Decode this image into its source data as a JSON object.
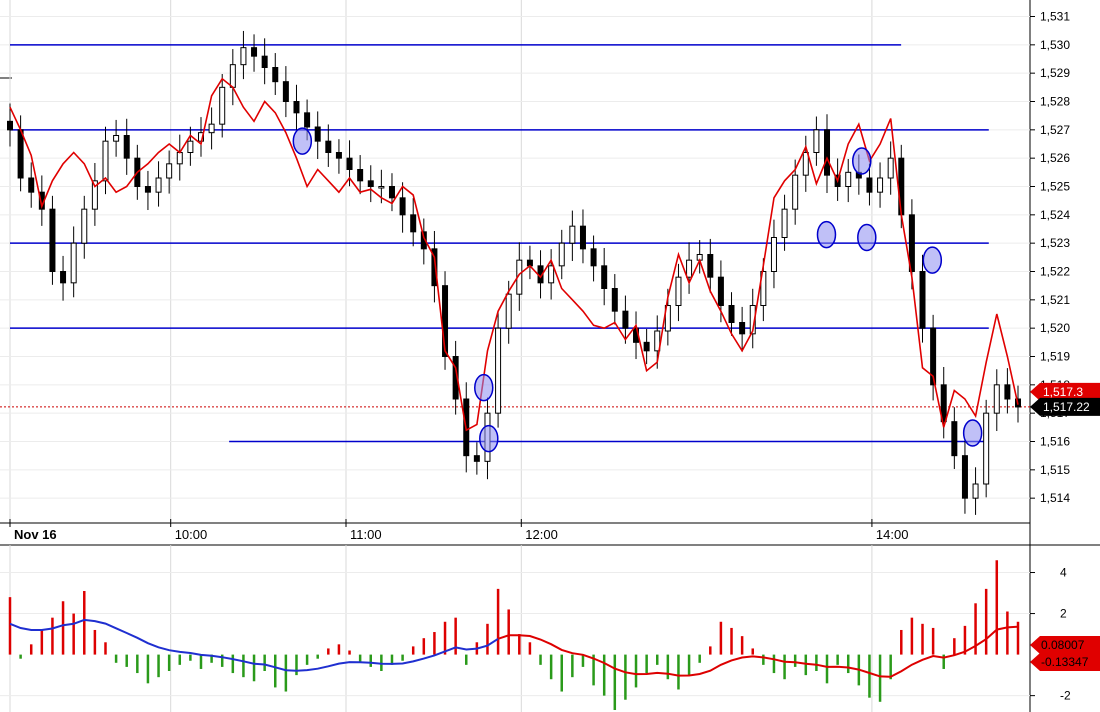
{
  "chart_data": [
    {
      "type": "candlestick",
      "panel": "price",
      "ylim": [
        1513.3,
        1531.3
      ],
      "y_ticks": [
        "1,514",
        "1,515",
        "1,516",
        "1,517",
        "1,518",
        "1,519",
        "1,520",
        "1,521",
        "1,522",
        "1,523",
        "1,524",
        "1,525",
        "1,526",
        "1,527",
        "1,528",
        "1,529",
        "1,530",
        "1,531"
      ],
      "x_labels": [
        {
          "label": "Nov 16",
          "time": "09:05"
        },
        {
          "label": "10:00",
          "time": "10:00"
        },
        {
          "label": "11:00",
          "time": "11:00"
        },
        {
          "label": "12:00",
          "time": "12:00"
        },
        {
          "label": "14:00",
          "time": "14:00"
        }
      ],
      "time_range": [
        "09:05",
        "14:50"
      ],
      "horizontal_levels": [
        {
          "value": 1530,
          "from": "09:05",
          "to": "14:10"
        },
        {
          "value": 1527,
          "from": "09:05",
          "to": "14:40"
        },
        {
          "value": 1523,
          "from": "09:05",
          "to": "14:40"
        },
        {
          "value": 1520,
          "from": "09:05",
          "to": "14:40"
        },
        {
          "value": 1516,
          "from": "10:20",
          "to": "14:40"
        }
      ],
      "last_price": {
        "label": "1,517.22",
        "value": 1517.22
      },
      "red_line_last": {
        "label": "1,517.3",
        "value": 1517.3
      },
      "candles_close": [
        1527.0,
        1525.3,
        1524.8,
        1524.2,
        1522.0,
        1521.6,
        1523.0,
        1524.2,
        1525.2,
        1526.6,
        1526.8,
        1526.0,
        1525.0,
        1524.8,
        1525.3,
        1525.8,
        1526.2,
        1526.6,
        1526.9,
        1527.2,
        1528.5,
        1529.3,
        1529.9,
        1529.6,
        1529.2,
        1528.7,
        1528.0,
        1527.6,
        1527.1,
        1526.6,
        1526.2,
        1526.0,
        1525.6,
        1525.2,
        1525.0,
        1525.0,
        1524.6,
        1524.0,
        1523.4,
        1522.8,
        1521.5,
        1519.0,
        1517.5,
        1515.5,
        1515.3,
        1517.0,
        1520.0,
        1521.2,
        1522.4,
        1522.2,
        1521.6,
        1522.2,
        1523.0,
        1523.6,
        1522.8,
        1522.2,
        1521.4,
        1520.6,
        1520.0,
        1519.5,
        1519.2,
        1519.9,
        1520.8,
        1521.8,
        1522.4,
        1522.6,
        1521.8,
        1520.8,
        1520.2,
        1519.8,
        1520.8,
        1522.0,
        1523.2,
        1524.2,
        1525.4,
        1526.2,
        1527.0,
        1525.4,
        1525.0,
        1525.5,
        1525.3,
        1524.8,
        1525.3,
        1526.0,
        1524.0,
        1522.0,
        1520.0,
        1518.0,
        1516.7,
        1515.5,
        1514.0,
        1514.5,
        1517.0,
        1518.0,
        1517.5,
        1517.22
      ],
      "indicator_line": [
        1527.8,
        1527.0,
        1526.1,
        1524.3,
        1525.2,
        1525.8,
        1526.2,
        1525.8,
        1525.0,
        1525.3,
        1524.8,
        1525.0,
        1525.5,
        1525.8,
        1526.2,
        1526.5,
        1526.2,
        1526.8,
        1526.5,
        1528.2,
        1528.8,
        1528.5,
        1527.8,
        1527.3,
        1528.0,
        1527.6,
        1526.9,
        1526.0,
        1525.0,
        1525.6,
        1525.2,
        1524.8,
        1525.3,
        1524.8,
        1524.9,
        1524.6,
        1524.4,
        1525.0,
        1524.7,
        1523.2,
        1522.5,
        1519.2,
        1518.6,
        1516.4,
        1516.6,
        1519.2,
        1520.6,
        1521.3,
        1521.9,
        1522.2,
        1521.8,
        1522.4,
        1521.4,
        1521.0,
        1520.6,
        1520.1,
        1520.0,
        1520.2,
        1519.6,
        1520.1,
        1518.5,
        1518.8,
        1521.1,
        1522.6,
        1521.6,
        1522.4,
        1521.3,
        1520.6,
        1519.8,
        1519.2,
        1519.9,
        1522.2,
        1524.6,
        1525.2,
        1525.6,
        1526.4,
        1525.1,
        1526.0,
        1525.2,
        1526.5,
        1527.2,
        1525.9,
        1526.5,
        1527.4,
        1524.0,
        1521.8,
        1518.6,
        1518.3,
        1516.5,
        1517.8,
        1517.5,
        1516.9,
        1518.8,
        1520.5,
        1519.0,
        1517.3
      ]
    },
    {
      "type": "histogram",
      "panel": "oscillator",
      "ylim": [
        -2.7,
        5.0
      ],
      "y_ticks": [
        "4",
        "2",
        "-2"
      ],
      "last_values": [
        {
          "label": "0.08007",
          "value": 0.08007
        },
        {
          "label": "-0.13347",
          "value": -0.13347
        }
      ],
      "histogram": [
        2.8,
        -0.2,
        0.5,
        1.2,
        1.8,
        2.6,
        2.0,
        3.1,
        1.2,
        0.6,
        -0.4,
        -0.6,
        -0.9,
        -1.4,
        -1.1,
        -0.8,
        -0.5,
        -0.3,
        -0.7,
        -0.4,
        -0.6,
        -0.9,
        -1.1,
        -1.3,
        -0.8,
        -1.6,
        -1.8,
        -1.0,
        -0.5,
        -0.2,
        0.3,
        0.5,
        0.2,
        -0.4,
        -0.6,
        -0.8,
        -0.5,
        -0.3,
        0.4,
        0.8,
        1.1,
        1.6,
        1.8,
        -0.5,
        0.6,
        1.5,
        3.2,
        2.2,
        1.0,
        0.6,
        -0.5,
        -1.2,
        -1.8,
        -1.1,
        -0.6,
        -1.5,
        -2.0,
        -2.7,
        -2.2,
        -1.6,
        -0.9,
        -0.5,
        -1.2,
        -1.7,
        -1.0,
        -0.4,
        0.4,
        1.6,
        1.3,
        0.9,
        0.3,
        -0.5,
        -0.9,
        -1.2,
        -0.6,
        -1.0,
        -0.8,
        -1.4,
        -0.5,
        -0.9,
        -1.5,
        -2.1,
        -2.3,
        -1.2,
        1.2,
        1.8,
        1.5,
        1.3,
        -0.7,
        0.8,
        1.4,
        2.5,
        3.2,
        4.6,
        2.1,
        1.6
      ]
    }
  ]
}
